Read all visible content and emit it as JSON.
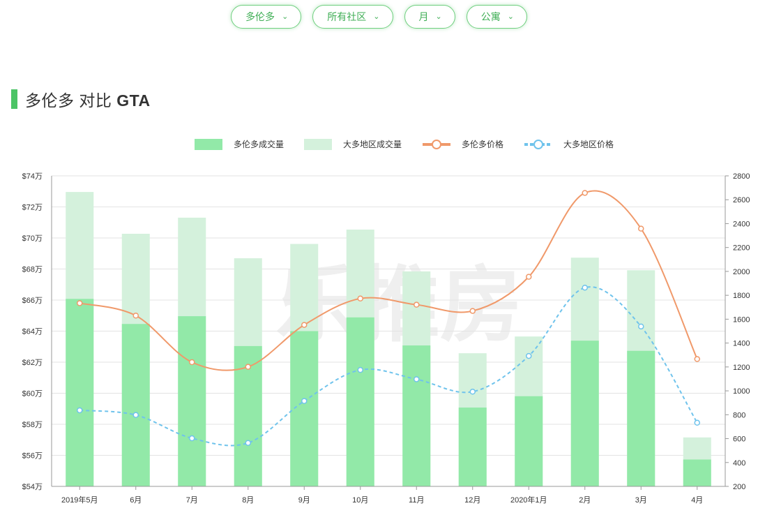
{
  "filters": [
    {
      "label": "多伦多"
    },
    {
      "label": "所有社区"
    },
    {
      "label": "月"
    },
    {
      "label": "公寓"
    }
  ],
  "section": {
    "title_a": "多伦多 对比 ",
    "title_b": "GTA"
  },
  "watermark": "乐推房",
  "colors": {
    "bar_toronto": "#92e9a8",
    "bar_gta": "#d4f1dc",
    "line_toronto": "#f0996a",
    "line_gta": "#6fc3ec",
    "accent": "#4cc466"
  },
  "chart_data": {
    "type": "bar+line",
    "categories": [
      "2019年5月",
      "6月",
      "7月",
      "8月",
      "9月",
      "10月",
      "11月",
      "12月",
      "2020年1月",
      "2月",
      "3月",
      "4月"
    ],
    "legend": [
      "多伦多成交量",
      "大多地区成交量",
      "多伦多价格",
      "大多地区价格"
    ],
    "legend_position": "top",
    "grid": true,
    "left_axis": {
      "min": 54,
      "max": 74,
      "step": 2,
      "ticks": [
        "$54万",
        "$56万",
        "$58万",
        "$60万",
        "$62万",
        "$64万",
        "$66万",
        "$68万",
        "$70万",
        "$72万",
        "$74万"
      ]
    },
    "right_axis": {
      "min": 200,
      "max": 2800,
      "step": 200,
      "ticks": [
        "200",
        "400",
        "600",
        "800",
        "1000",
        "1200",
        "1400",
        "1600",
        "1800",
        "2000",
        "2200",
        "2400",
        "2600",
        "2800"
      ]
    },
    "series": [
      {
        "name": "多伦多成交量",
        "type": "bar",
        "axis": "right",
        "values": [
          1770,
          1560,
          1625,
          1375,
          1500,
          1615,
          1380,
          860,
          955,
          1420,
          1335,
          425
        ]
      },
      {
        "name": "大多地区成交量",
        "type": "bar",
        "axis": "right",
        "values": [
          2665,
          2315,
          2450,
          2110,
          2230,
          2350,
          2000,
          1315,
          1455,
          2115,
          2010,
          610
        ]
      },
      {
        "name": "多伦多价格",
        "type": "line",
        "axis": "left",
        "smooth": true,
        "values": [
          65.8,
          65.0,
          62.0,
          61.7,
          64.4,
          66.1,
          65.7,
          65.3,
          67.5,
          72.9,
          70.6,
          62.2
        ]
      },
      {
        "name": "大多地区价格",
        "type": "line",
        "axis": "left",
        "smooth": true,
        "dashed": true,
        "values": [
          58.9,
          58.6,
          57.1,
          56.8,
          59.5,
          61.5,
          60.9,
          60.1,
          62.4,
          66.8,
          64.3,
          58.1
        ]
      }
    ]
  }
}
